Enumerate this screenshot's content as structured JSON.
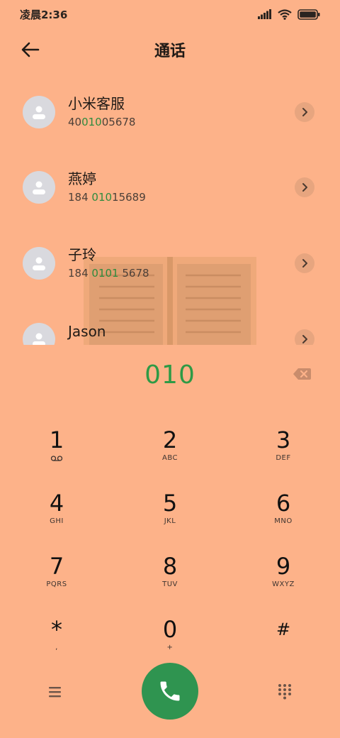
{
  "status_bar": {
    "time": "凌晨2:36"
  },
  "header": {
    "title": "通话"
  },
  "contacts": [
    {
      "name": "小米客服",
      "number_parts": [
        "40",
        "010",
        "05678"
      ]
    },
    {
      "name": "燕婷",
      "number_parts": [
        "184 ",
        "010",
        "15689"
      ]
    },
    {
      "name": "子玲",
      "number_parts": [
        "184 ",
        "0101",
        " 5678"
      ]
    },
    {
      "name": "Jason"
    }
  ],
  "dialer": {
    "dialed": "010"
  },
  "keypad": [
    {
      "digit": "1",
      "letters": ""
    },
    {
      "digit": "2",
      "letters": "ABC"
    },
    {
      "digit": "3",
      "letters": "DEF"
    },
    {
      "digit": "4",
      "letters": "GHI"
    },
    {
      "digit": "5",
      "letters": "JKL"
    },
    {
      "digit": "6",
      "letters": "MNO"
    },
    {
      "digit": "7",
      "letters": "PQRS"
    },
    {
      "digit": "8",
      "letters": "TUV"
    },
    {
      "digit": "9",
      "letters": "WXYZ"
    },
    {
      "digit": "*",
      "letters": ","
    },
    {
      "digit": "0",
      "letters": "+"
    },
    {
      "digit": "#",
      "letters": ""
    }
  ],
  "colors": {
    "background": "#FDB289",
    "highlight": "#2E9A45",
    "call_button": "#2F9450"
  },
  "icons": {
    "back": "arrow-left-icon",
    "detail": "chevron-right-icon",
    "backspace": "backspace-icon",
    "voicemail": "voicemail-icon",
    "menu": "menu-icon",
    "call": "phone-icon",
    "dialpad": "dialpad-icon"
  }
}
